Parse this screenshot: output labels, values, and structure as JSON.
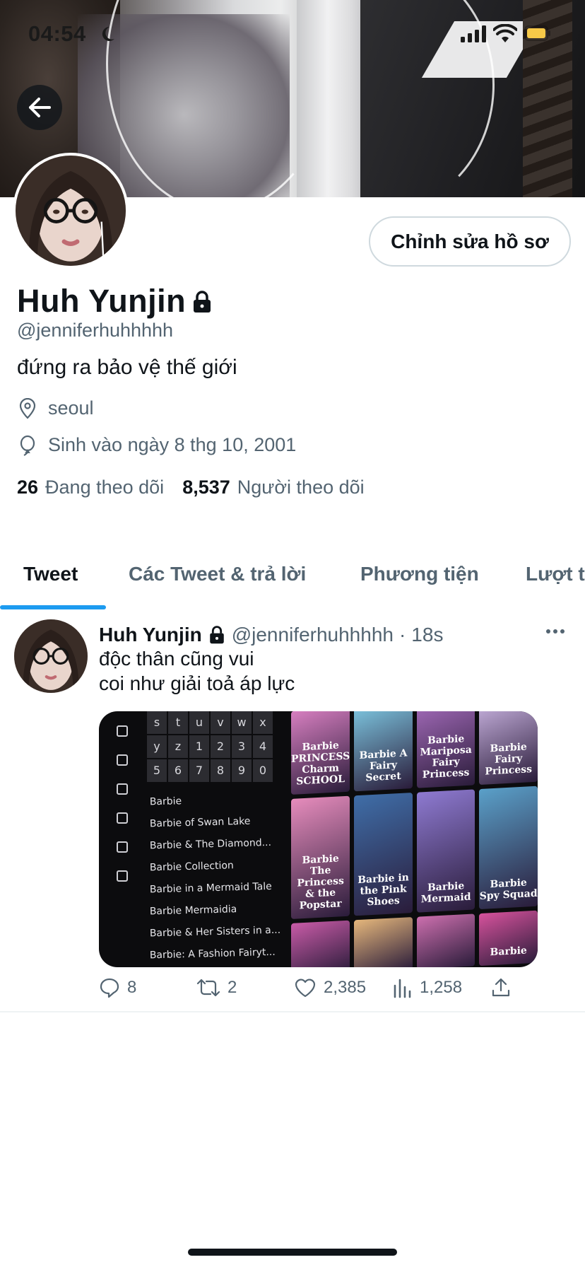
{
  "status_bar": {
    "time": "04:54",
    "icons": [
      "moon-icon",
      "signal-icon",
      "wifi-icon",
      "battery-icon"
    ],
    "battery_color": "#f7c948"
  },
  "nav": {
    "back_icon": "arrow-left-icon"
  },
  "profile": {
    "name": "Huh Yunjin",
    "protected_icon": "lock-icon",
    "handle": "@jenniferhuhhhhh",
    "bio": "đứng ra bảo vệ thế giới",
    "location": "seoul",
    "birthday": "Sinh vào ngày 8 thg 10, 2001",
    "following_count": "26",
    "following_label": "Đang theo dõi",
    "followers_count": "8,537",
    "followers_label": "Người theo dõi",
    "edit_button_label": "Chỉnh sửa hồ sơ"
  },
  "tabs": [
    {
      "label": "Tweet",
      "active": true
    },
    {
      "label": "Các Tweet & trả lời",
      "active": false
    },
    {
      "label": "Phương tiện",
      "active": false
    },
    {
      "label": "Lượt t",
      "active": false
    }
  ],
  "tweet": {
    "name": "Huh Yunjin",
    "handle": "@jenniferhuhhhhh",
    "separator": "·",
    "time": "18s",
    "text_line1": "độc thân cũng vui",
    "text_line2": "coi như giải toả áp lực",
    "media": {
      "keyboard_keys": [
        "s",
        "t",
        "u",
        "v",
        "w",
        "x",
        "y",
        "z",
        "1",
        "2",
        "3",
        "4",
        "5",
        "6",
        "7",
        "8",
        "9",
        "0"
      ],
      "list_items": [
        "Barbie",
        "Barbie of Swan Lake",
        "Barbie & The Diamond...",
        "Barbie Collection",
        "Barbie in a Mermaid Tale",
        "Barbie Mermaidia",
        "Barbie & Her Sisters in a...",
        "Barbie: A Fashion Fairyt..."
      ],
      "posters": [
        {
          "label": "Barbie PRINCESS Charm SCHOOL",
          "color": "#d77fc0"
        },
        {
          "label": "Barbie A Fairy Secret",
          "color": "#7cc4de"
        },
        {
          "label": "Barbie Mariposa Fairy Princess",
          "color": "#a26ab8"
        },
        {
          "label": "Barbie Fairy Princess",
          "color": "#c9b3e0"
        },
        {
          "label": "Barbie The Princess & the Popstar",
          "color": "#e68cbc"
        },
        {
          "label": "Barbie in the Pink Shoes",
          "color": "#3f6ea8"
        },
        {
          "label": "Barbie Mermaid",
          "color": "#8e7ad1"
        },
        {
          "label": "Barbie Spy Squad",
          "color": "#5aa0c9"
        },
        {
          "label": "",
          "color": "#c85ba7"
        },
        {
          "label": "",
          "color": "#e5b77c"
        },
        {
          "label": "",
          "color": "#cc6fae"
        },
        {
          "label": "Barbie",
          "color": "#d6529c"
        }
      ]
    },
    "actions": {
      "replies": "8",
      "retweets": "2",
      "likes": "2,385",
      "views": "1,258"
    }
  },
  "colors": {
    "accent": "#1d9bf0",
    "secondary_text": "#536471",
    "primary_text": "#0f1419"
  }
}
